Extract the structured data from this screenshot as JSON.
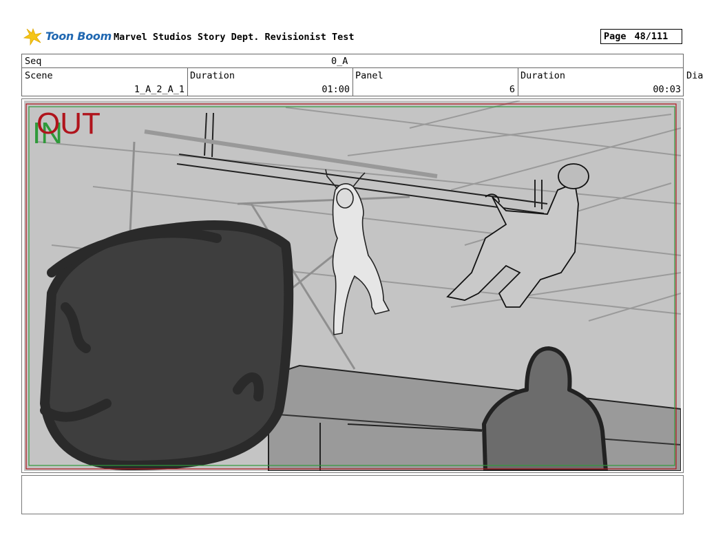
{
  "header": {
    "logo_text": "Toon Boom",
    "title": "Marvel Studios Story Dept. Revisionist Test",
    "page_label": "Page",
    "page_value": "48/111"
  },
  "seq": {
    "label": "Seq",
    "value": "0_A"
  },
  "info": {
    "scene_label": "Scene",
    "scene_value": "1_A_2_A_1",
    "duration1_label": "Duration",
    "duration1_value": "01:00",
    "panel_label": "Panel",
    "panel_value": "6",
    "duration2_label": "Duration",
    "duration2_value": "00:03",
    "dialogue_label": "Dia"
  },
  "panel": {
    "in_marker": "IN",
    "out_marker": "OUT",
    "colors": {
      "in": "#2f9a3a",
      "out": "#b0141c"
    }
  },
  "notes": {
    "text": ""
  }
}
